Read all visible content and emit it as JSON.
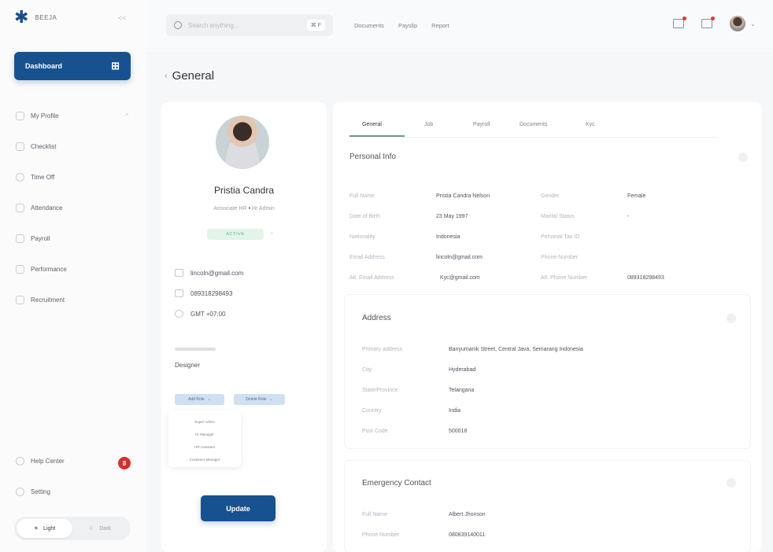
{
  "app": {
    "name": "BEEJA",
    "collapse_label": "<<"
  },
  "sidebar": {
    "dashboard_label": "Dashboard",
    "items": [
      {
        "label": "My Profile",
        "caret": "^"
      },
      {
        "label": "Checklist",
        "caret": ""
      },
      {
        "label": "Time Off",
        "caret": ""
      },
      {
        "label": "Attendance",
        "caret": ""
      },
      {
        "label": "Payroll",
        "caret": ""
      },
      {
        "label": "Performance",
        "caret": ""
      },
      {
        "label": "Recruitment",
        "caret": ""
      }
    ],
    "help_label": "Help Center",
    "help_badge": "8",
    "setting_label": "Setting",
    "theme_light": "Light",
    "theme_dark": "Dark"
  },
  "topbar": {
    "search_placeholder": "Search anything...",
    "shortcut": "⌘ F",
    "links": [
      "Documents",
      "Payslip",
      "Report"
    ]
  },
  "page": {
    "title": "General"
  },
  "profile": {
    "name": "Pristia Candra",
    "role": "Associate HR",
    "role_sep": "•",
    "role2": "Hr Admin",
    "status": "ACTIVE",
    "email": "lincoln@gmail.com",
    "phone": "089318298493",
    "timezone": "GMT +07:00",
    "department_value": "Designer",
    "add_role_label": "Add Role",
    "delete_role_label": "Delete Role",
    "role_options": [
      "Super Admin",
      "Hr Manager",
      "HR Assistant",
      "Customer Manager"
    ],
    "update_label": "Update"
  },
  "tabs": [
    "General",
    "Job",
    "Payroll",
    "Documents",
    "Kyc"
  ],
  "personal_info": {
    "title": "Personal Info",
    "left": [
      {
        "label": "Full Name",
        "value": "Pristia Candra Nelson"
      },
      {
        "label": "Date of Birth",
        "value": "23 May 1997"
      },
      {
        "label": "Nationality",
        "value": "Indonesia"
      },
      {
        "label": "Email Address",
        "value": "lincoln@gmail.com"
      },
      {
        "label": "Alt. Email Address",
        "value": "Kyc@gmail.com"
      }
    ],
    "right": [
      {
        "label": "Gender",
        "value": "Female"
      },
      {
        "label": "Marital Status",
        "value": "-"
      },
      {
        "label": "Personal Tax ID",
        "value": ""
      },
      {
        "label": "Phone Number",
        "value": ""
      },
      {
        "label": "Alt. Phone Number",
        "value": "089318298493"
      }
    ]
  },
  "address": {
    "title": "Address",
    "rows": [
      {
        "label": "Primary address",
        "value": "Banyumanik Street, Central Java, Semarang Indonesia"
      },
      {
        "label": "City",
        "value": "Hyderabad"
      },
      {
        "label": "State/Province",
        "value": "Telangana"
      },
      {
        "label": "Country",
        "value": "India"
      },
      {
        "label": "Post Code",
        "value": "500018"
      }
    ]
  },
  "emergency": {
    "title": "Emergency Contact",
    "rows": [
      {
        "label": "Full Name",
        "value": "Albert Jhonson"
      },
      {
        "label": "Phone Number",
        "value": "080839140011"
      }
    ]
  }
}
